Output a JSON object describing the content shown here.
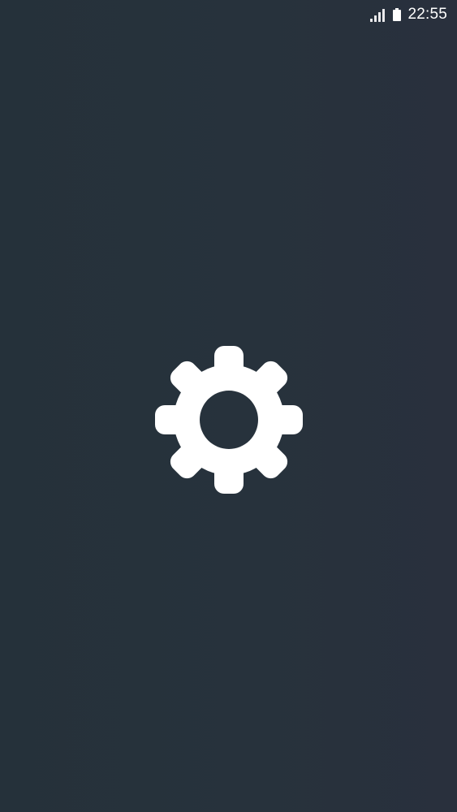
{
  "status_bar": {
    "time": "22:55",
    "signal_icon": "signal-strength-icon",
    "battery_icon": "battery-icon"
  },
  "splash": {
    "icon": "gear-icon",
    "icon_color": "#ffffff",
    "background_color": "#263139"
  }
}
